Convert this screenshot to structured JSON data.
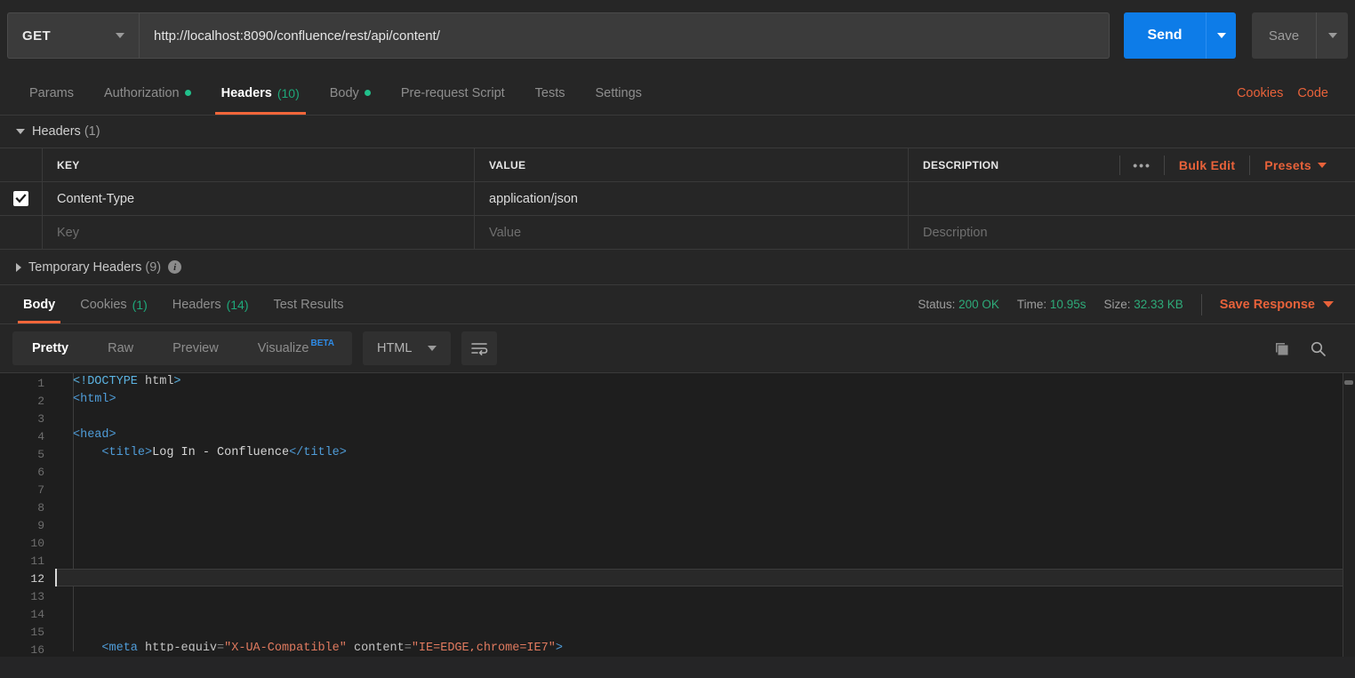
{
  "request": {
    "method": "GET",
    "method_caret_icon": "chevron-down-icon",
    "url_value": "http://localhost:8090/confluence/rest/api/content/",
    "url_placeholder": "Enter request URL",
    "send_label": "Send",
    "send_caret_icon": "chevron-down-icon",
    "save_label": "Save",
    "save_caret_icon": "chevron-down-icon",
    "accent_blue": "#0d7ce8",
    "accent_orange": "#f3663a",
    "accent_green": "#21c08b"
  },
  "request_tabs": [
    {
      "label": "Params",
      "count": "",
      "dot": false,
      "active": false
    },
    {
      "label": "Authorization",
      "count": "",
      "dot": true,
      "active": false
    },
    {
      "label": "Headers",
      "count": "(10)",
      "dot": false,
      "active": true
    },
    {
      "label": "Body",
      "count": "",
      "dot": true,
      "active": false
    },
    {
      "label": "Pre-request Script",
      "count": "",
      "dot": false,
      "active": false
    },
    {
      "label": "Tests",
      "count": "",
      "dot": false,
      "active": false
    },
    {
      "label": "Settings",
      "count": "",
      "dot": false,
      "active": false
    }
  ],
  "tabs_right": [
    {
      "label": "Cookies"
    },
    {
      "label": "Code"
    }
  ],
  "headers_section": {
    "title": "Headers",
    "count": "(1)",
    "expanded": true,
    "columns": [
      "KEY",
      "VALUE",
      "DESCRIPTION"
    ],
    "actions": {
      "more_icon": "•••",
      "bulk_edit_label": "Bulk Edit",
      "presets_label": "Presets",
      "presets_caret_icon": "chevron-down-icon"
    },
    "rows": [
      {
        "checked": true,
        "key": "Content-Type",
        "value": "application/json",
        "description": ""
      }
    ],
    "new_row": {
      "key_placeholder": "Key",
      "value_placeholder": "Value",
      "description_placeholder": "Description"
    }
  },
  "temporary_headers": {
    "title": "Temporary Headers",
    "count": "(9)",
    "info_icon": "info-icon",
    "expanded": false
  },
  "response_tabs": [
    {
      "label": "Body",
      "count": "",
      "active": true
    },
    {
      "label": "Cookies",
      "count": "(1)",
      "active": false
    },
    {
      "label": "Headers",
      "count": "(14)",
      "active": false
    },
    {
      "label": "Test Results",
      "count": "",
      "active": false
    }
  ],
  "response_meta": {
    "status_label": "Status:",
    "status_value": "200 OK",
    "time_label": "Time:",
    "time_value": "10.95s",
    "size_label": "Size:",
    "size_value": "32.33 KB",
    "save_response_label": "Save Response",
    "save_response_caret_icon": "chevron-down-icon"
  },
  "viewer": {
    "modes": [
      {
        "label": "Pretty",
        "active": true
      },
      {
        "label": "Raw",
        "active": false
      },
      {
        "label": "Preview",
        "active": false
      },
      {
        "label": "Visualize",
        "badge": "BETA",
        "active": false
      }
    ],
    "language": "HTML",
    "language_caret_icon": "chevron-down-icon",
    "wrap_icon": "text-wrap-icon",
    "copy_icon": "copy-icon",
    "search_icon": "search-icon"
  },
  "code": {
    "active_line": 12,
    "lines": [
      {
        "n": 1,
        "tokens": [
          {
            "t": "<!DOCTYPE ",
            "c": "tk-doc"
          },
          {
            "t": "html",
            "c": "tk-attr2"
          },
          {
            "t": ">",
            "c": "tk-doc"
          }
        ]
      },
      {
        "n": 2,
        "tokens": [
          {
            "t": "<html>",
            "c": "tk-tag"
          }
        ]
      },
      {
        "n": 3,
        "tokens": []
      },
      {
        "n": 4,
        "tokens": [
          {
            "t": "<head>",
            "c": "tk-tag"
          }
        ]
      },
      {
        "n": 5,
        "tokens": [
          {
            "t": "    <title>",
            "c": "tk-tag"
          },
          {
            "t": "Log In - Confluence",
            "c": "tk-txt"
          },
          {
            "t": "</title>",
            "c": "tk-tag"
          }
        ]
      },
      {
        "n": 6,
        "tokens": []
      },
      {
        "n": 7,
        "tokens": []
      },
      {
        "n": 8,
        "tokens": []
      },
      {
        "n": 9,
        "tokens": []
      },
      {
        "n": 10,
        "tokens": []
      },
      {
        "n": 11,
        "tokens": []
      },
      {
        "n": 12,
        "tokens": []
      },
      {
        "n": 13,
        "tokens": []
      },
      {
        "n": 14,
        "tokens": []
      },
      {
        "n": 15,
        "tokens": []
      },
      {
        "n": 16,
        "tokens": [
          {
            "t": "    <meta ",
            "c": "tk-tag"
          },
          {
            "t": "http-equiv",
            "c": "tk-attr2"
          },
          {
            "t": "=",
            "c": "tk-punc"
          },
          {
            "t": "\"X-UA-Compatible\"",
            "c": "tk-str"
          },
          {
            "t": " ",
            "c": "tk-txt"
          },
          {
            "t": "content",
            "c": "tk-attr2"
          },
          {
            "t": "=",
            "c": "tk-punc"
          },
          {
            "t": "\"IE=EDGE,chrome=IE7\"",
            "c": "tk-str"
          },
          {
            "t": ">",
            "c": "tk-tag"
          }
        ]
      }
    ]
  }
}
